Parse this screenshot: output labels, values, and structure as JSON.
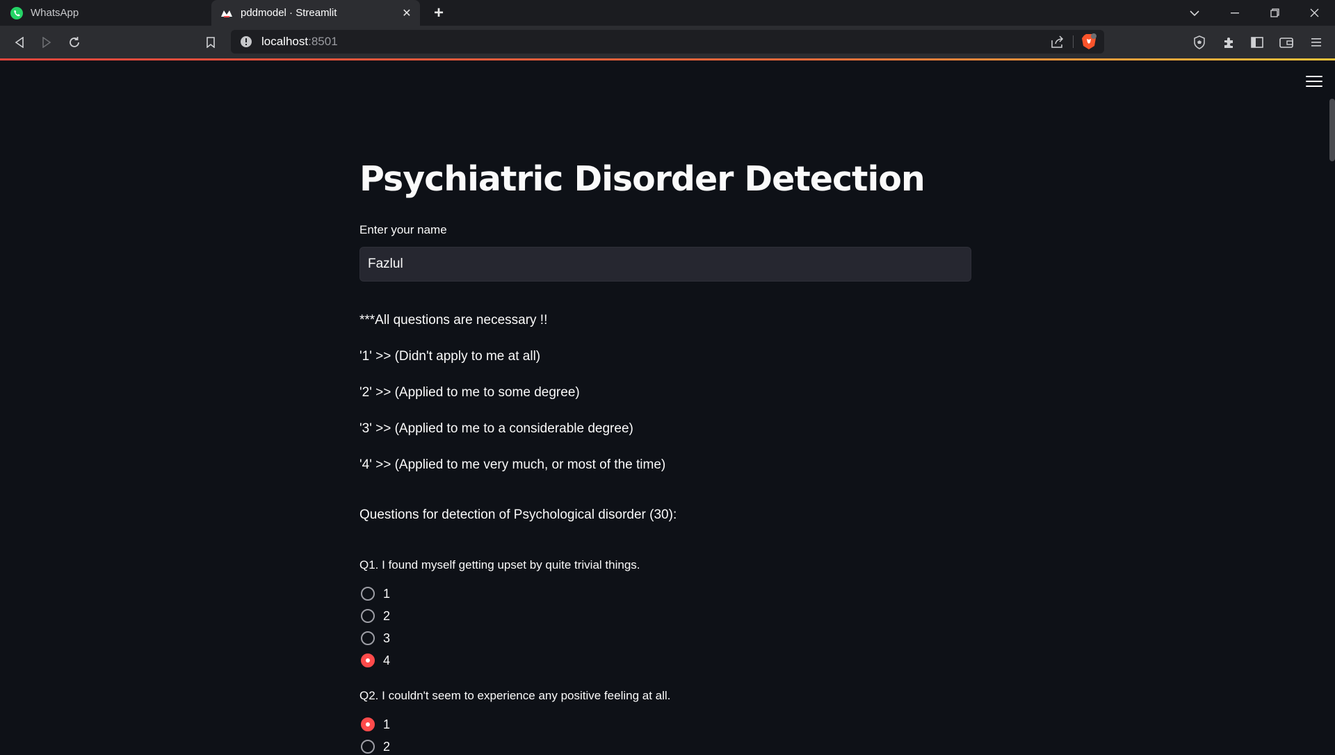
{
  "browser": {
    "tabs": [
      {
        "title": "WhatsApp",
        "icon": "whatsapp-icon",
        "active": false
      },
      {
        "title": "pddmodel · Streamlit",
        "icon": "streamlit-icon",
        "active": true
      }
    ],
    "url": {
      "host": "localhost",
      "port": ":8501"
    },
    "accent_gradient": [
      "#e8453c",
      "#f5c33b"
    ]
  },
  "app": {
    "title": "Psychiatric Disorder Detection",
    "name_label": "Enter your name",
    "name_value": "Fazlul",
    "notes": [
      "***All questions are necessary !!",
      "'1' >> (Didn't apply to me at all)",
      "'2' >> (Applied to me to some degree)",
      "'3' >> (Applied to me to a considerable degree)",
      "'4' >> (Applied to me very much, or most of the time)"
    ],
    "section_heading": "Questions for detection of Psychological disorder (30):",
    "questions": [
      {
        "text": "Q1. I found myself getting upset by quite trivial things.",
        "options": [
          "1",
          "2",
          "3",
          "4"
        ],
        "selected": "4"
      },
      {
        "text": "Q2. I couldn't seem to experience any positive feeling at all.",
        "options": [
          "1",
          "2"
        ],
        "selected": "1"
      }
    ],
    "colors": {
      "background": "#0e1117",
      "accent": "#ff4b4b",
      "input_bg": "#262730"
    }
  }
}
